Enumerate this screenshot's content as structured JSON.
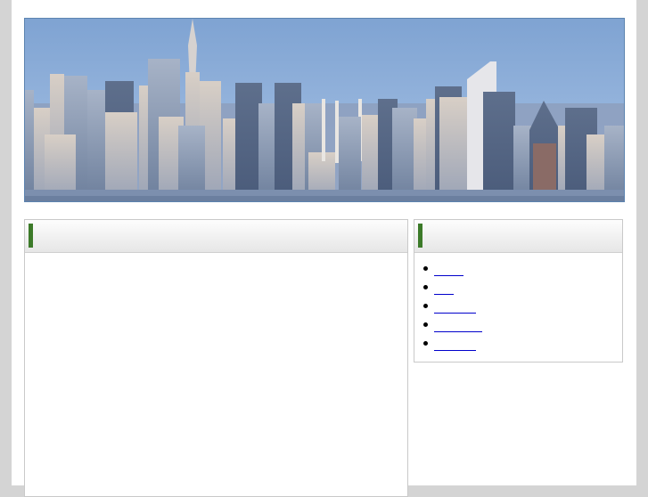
{
  "banner": {
    "alt": "city skyline"
  },
  "main_panel": {
    "title": ""
  },
  "side_panel": {
    "title": "",
    "links": [
      {
        "label": ""
      },
      {
        "label": ""
      },
      {
        "label": ""
      },
      {
        "label": ""
      },
      {
        "label": ""
      }
    ]
  }
}
